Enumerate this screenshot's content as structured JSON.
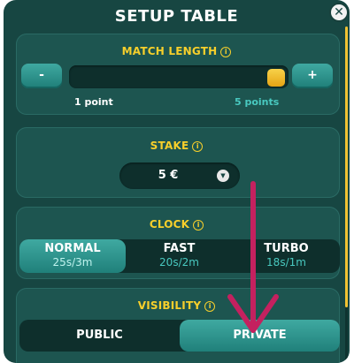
{
  "dialog": {
    "title": "SETUP TABLE",
    "close_icon": "close-icon"
  },
  "match_length": {
    "title": "MATCH LENGTH",
    "info_icon": "info-icon",
    "minus_label": "-",
    "plus_label": "+",
    "min_label": "1 point",
    "max_label": "5 points",
    "slider_value": 5,
    "slider_min": 1,
    "slider_max": 5
  },
  "stake": {
    "title": "STAKE",
    "value": "5 €",
    "dropdown_icon": "chevron-down-icon"
  },
  "clock": {
    "title": "CLOCK",
    "options": [
      {
        "name": "NORMAL",
        "detail": "25s/3m",
        "selected": true
      },
      {
        "name": "FAST",
        "detail": "20s/2m",
        "selected": false
      },
      {
        "name": "TURBO",
        "detail": "18s/1m",
        "selected": false
      }
    ]
  },
  "visibility": {
    "title": "VISIBILITY",
    "options": [
      {
        "name": "PUBLIC",
        "selected": false
      },
      {
        "name": "PRIVATE",
        "selected": true
      }
    ]
  },
  "colors": {
    "panel": "#174642",
    "card": "#1d5550",
    "accent_yellow": "#f7cf2b",
    "accent_teal": "#3fa9a1",
    "annotation_arrow": "#c4215f"
  }
}
